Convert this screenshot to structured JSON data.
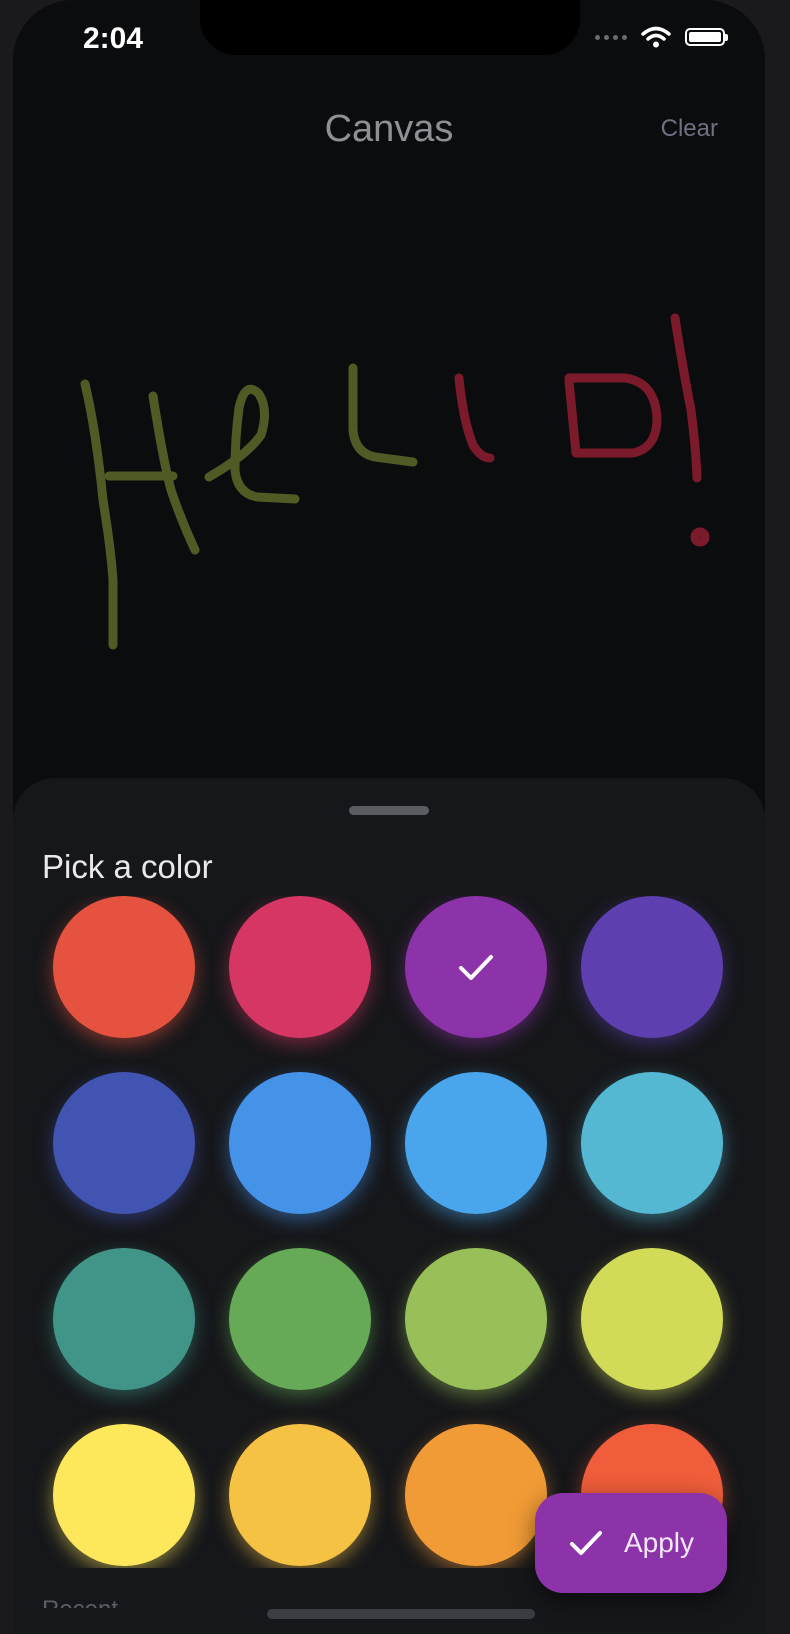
{
  "status": {
    "time": "2:04"
  },
  "header": {
    "title": "Canvas",
    "clear_label": "Clear"
  },
  "canvas": {
    "drawing_text": "HELLO!",
    "stroke_colors": [
      "#4f5a24",
      "#7b1a2a"
    ]
  },
  "sheet": {
    "title": "Pick a color",
    "partial_label": "Recent",
    "selected_index": 2,
    "swatches": [
      "#e5523f",
      "#d63663",
      "#8d33a9",
      "#5e3fb0",
      "#4154b1",
      "#4592e9",
      "#4aa6ec",
      "#54b8d2",
      "#419488",
      "#66aa58",
      "#98bf58",
      "#d2db58",
      "#fde85b",
      "#f5c243",
      "#f19b36",
      "#ef5d3a"
    ]
  },
  "apply": {
    "label": "Apply"
  }
}
